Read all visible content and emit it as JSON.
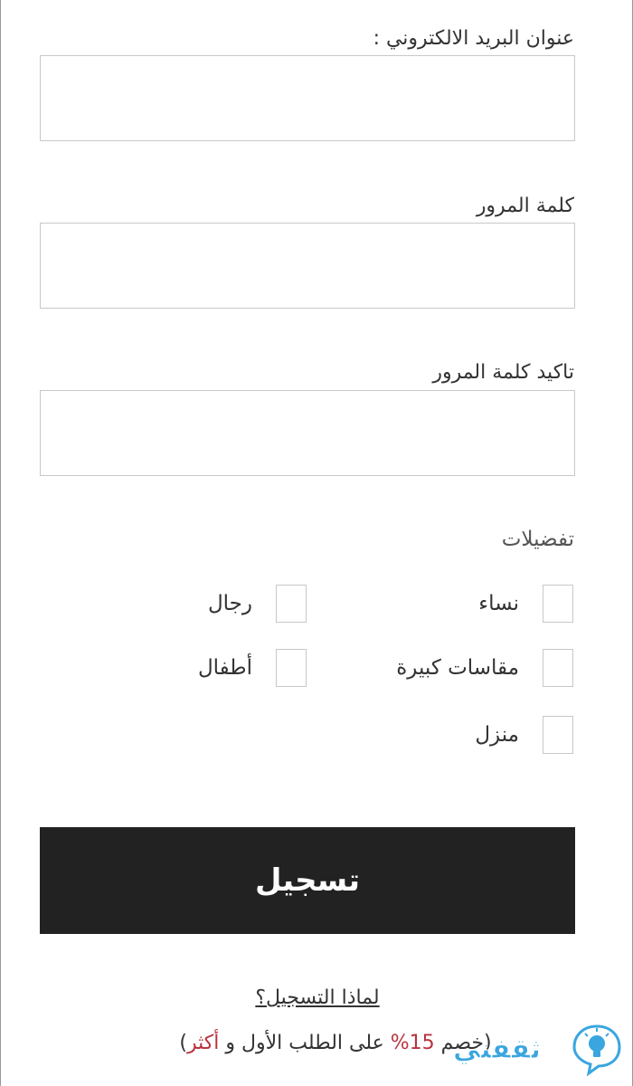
{
  "form": {
    "email_label": "عنوان البريد الالكتروني :",
    "email_value": "",
    "password_label": "كلمة المرور",
    "password_value": "",
    "confirm_password_label": "تاكيد كلمة المرور",
    "confirm_password_value": ""
  },
  "preferences": {
    "title": "تفضيلات",
    "items": [
      {
        "label": "نساء",
        "checked": false
      },
      {
        "label": "رجال",
        "checked": false
      },
      {
        "label": "مقاسات كبيرة",
        "checked": false
      },
      {
        "label": "أطفال",
        "checked": false
      },
      {
        "label": "منزل",
        "checked": false
      }
    ]
  },
  "actions": {
    "register_label": "تسجيل",
    "why_register_link": "لماذا التسجيل؟"
  },
  "promo": {
    "part1": "(خصم",
    "percent": "15%",
    "part2": "على الطلب الأول و",
    "more": "أكثر",
    "close_paren": ")"
  },
  "watermark": {
    "brand_text": "ثقفني",
    "icon": "lightbulb-bubble-icon",
    "color": "#3aa6df"
  },
  "colors": {
    "button_bg": "#222222",
    "accent": "#b8343f",
    "field_border": "#c8c8c8"
  }
}
